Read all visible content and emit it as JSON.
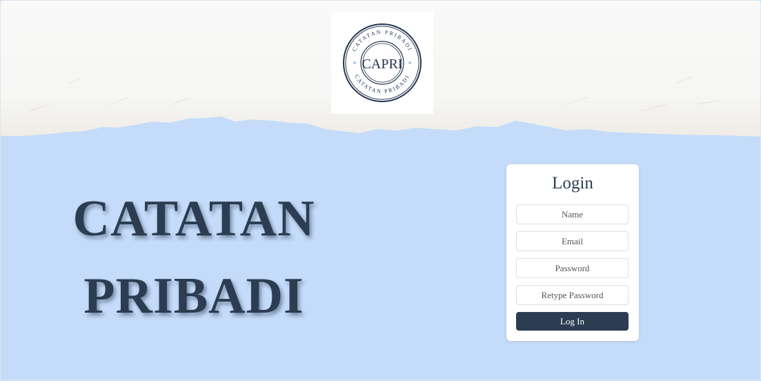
{
  "logo": {
    "center_text": "CAPRI",
    "ring_text": "CATATAN PRIBADI"
  },
  "hero": {
    "line1": "CATATAN",
    "line2": "PRIBADI"
  },
  "login": {
    "title": "Login",
    "name_placeholder": "Name",
    "email_placeholder": "Email",
    "password_placeholder": "Password",
    "retype_placeholder": "Retype Password",
    "submit_label": "Log In"
  },
  "colors": {
    "background": "#c4dcf9",
    "accent": "#2c3d52",
    "paper": "#f7f7f5"
  }
}
